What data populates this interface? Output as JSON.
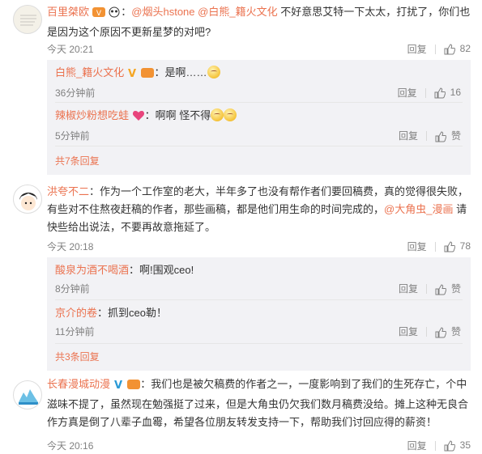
{
  "comments": [
    {
      "user": "百里桀欧",
      "text_pre": "：",
      "mention1": "@烟头hstone",
      "mention2": "@白熊_籍火文化",
      "text": " 不好意思艾特一下太太，打扰了，你们也是因为这个原因不更新星梦的对吧?",
      "time": "今天 20:21",
      "reply_label": "回复",
      "likes": "82",
      "subs": [
        {
          "user": "白熊_籍火文化",
          "text": "：是啊……",
          "time": "36分钟前",
          "reply_label": "回复",
          "likes": "16"
        },
        {
          "user": "辣椒炒粉想吃蛙",
          "text": "：啊啊 怪不得",
          "time": "5分钟前",
          "reply_label": "回复",
          "likes": "赞"
        }
      ],
      "more": "共7条回复"
    },
    {
      "user": "洪夸不二",
      "text": "：作为一个工作室的老大，半年多了也没有帮作者们要回稿费，真的觉得很失败，有些对不住熬夜赶稿的作者，那些画稿，都是他们用生命的时间完成的，",
      "mention1": "@大角虫_漫画",
      "text_post": " 请快些给出说法，不要再故意拖延了。",
      "time": "今天 20:18",
      "reply_label": "回复",
      "likes": "78",
      "subs": [
        {
          "user": "酸泉为酒不喝酒",
          "text": "：啊!围观ceo!",
          "time": "8分钟前",
          "reply_label": "回复",
          "likes": "赞"
        },
        {
          "user": "京介的卷",
          "text": "：抓到ceo勒！",
          "time": "11分钟前",
          "reply_label": "回复",
          "likes": "赞"
        }
      ],
      "more": "共3条回复"
    },
    {
      "user": "长春漫城动漫",
      "text": "：我们也是被欠稿费的作者之一，一度影响到了我们的生死存亡，个中滋味不提了，虽然现在勉强挺了过来，但是大角虫仍欠我们数月稿费没给。摊上这种无良合作方真是倒了八辈子血霉，希望各位朋友转发支持一下，帮助我们讨回应得的薪资！",
      "time": "今天 20:16",
      "reply_label": "回复",
      "likes": "35"
    }
  ]
}
